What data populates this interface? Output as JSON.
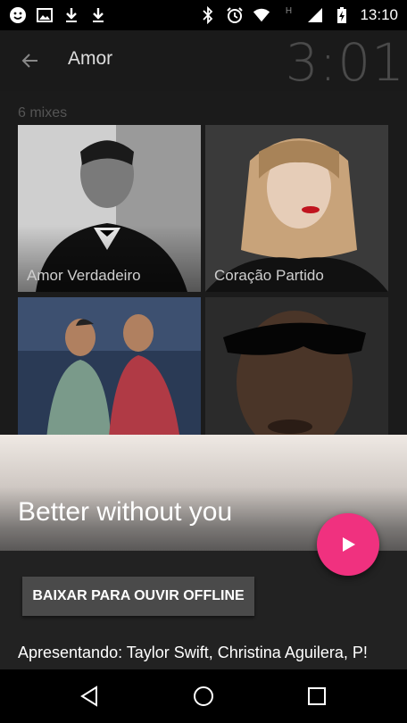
{
  "status_bar": {
    "time": "13:10",
    "left_icons": [
      "smiley-notification-icon",
      "image-notification-icon",
      "download-icon",
      "download-icon"
    ],
    "right_icons": [
      "bluetooth-icon",
      "alarm-icon",
      "wifi-icon",
      "hspa-icon",
      "signal-icon",
      "battery-charging-icon"
    ]
  },
  "app_bar": {
    "title": "Amor",
    "clock": "3:01"
  },
  "content": {
    "mix_count": "6 mixes",
    "mixes": [
      {
        "label": "Amor Verdadeiro"
      },
      {
        "label": "Coração Partido"
      },
      {
        "label": ""
      },
      {
        "label": ""
      }
    ]
  },
  "sheet": {
    "title": "Better without you",
    "offline_button": "BAIXAR PARA OUVIR OFFLINE",
    "featuring": "Apresentando: Taylor Swift, Christina Aguilera, P!"
  },
  "colors": {
    "accent": "#f0317f",
    "app_bar": "#1a1a1a",
    "sheet_body": "#222222"
  }
}
